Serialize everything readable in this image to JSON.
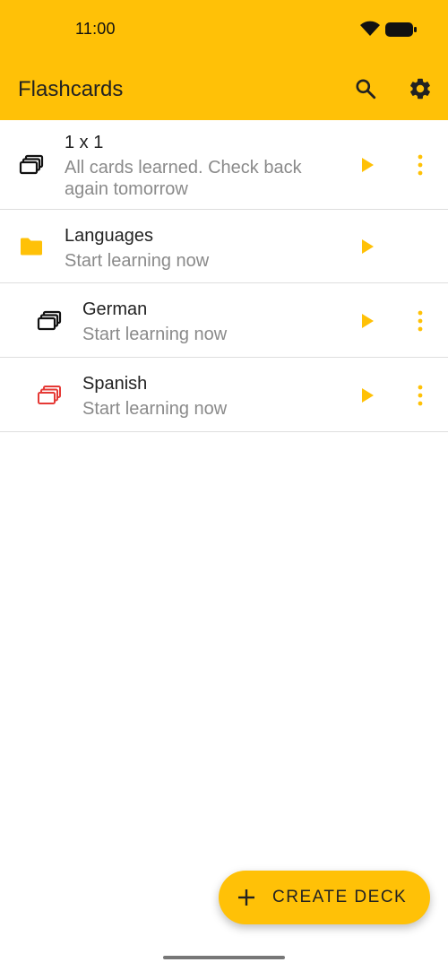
{
  "status_bar": {
    "time": "11:00"
  },
  "app_bar": {
    "title": "Flashcards",
    "icons": [
      "search-icon",
      "settings-icon"
    ]
  },
  "colors": {
    "accent": "#FFC107",
    "deck_icon_default": "#111111",
    "deck_icon_spanish": "#E53935",
    "subtitle": "#8A8A8A",
    "divider": "#DEDEDE"
  },
  "list": {
    "items": [
      {
        "type": "deck",
        "title": "1 x 1",
        "subtitle": "All cards learned. Check back again tomorrow",
        "icon": "deck-icon",
        "has_menu": true
      },
      {
        "type": "folder",
        "title": "Languages",
        "subtitle": "Start learning now",
        "icon": "folder-icon",
        "has_menu": false
      },
      {
        "type": "deck",
        "title": "German",
        "subtitle": "Start learning now",
        "icon": "deck-icon",
        "has_menu": true
      },
      {
        "type": "deck",
        "title": "Spanish",
        "subtitle": "Start learning now",
        "icon": "deck-icon",
        "has_menu": true
      }
    ]
  },
  "fab": {
    "label": "CREATE DECK",
    "icon": "plus-icon"
  }
}
